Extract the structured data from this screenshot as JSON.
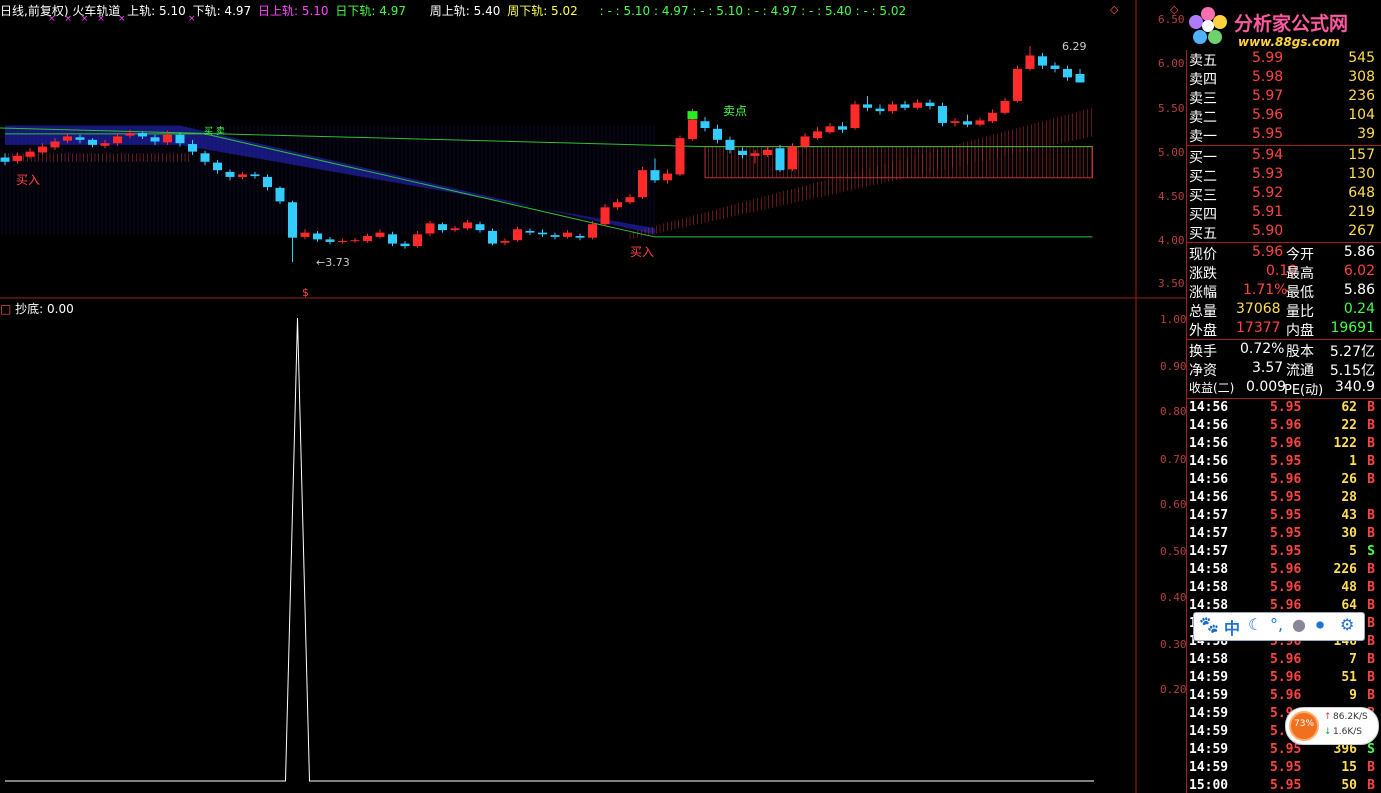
{
  "main_header": {
    "segments": [
      {
        "text": "日线,前复权)",
        "color": "#ffffff"
      },
      {
        "text": "火车轨道",
        "color": "#ffffff"
      },
      {
        "text": "上轨: 5.10",
        "color": "#ffffff"
      },
      {
        "text": "下轨: 4.97",
        "color": "#ffffff"
      },
      {
        "text": "日上轨: 5.10",
        "color": "#ff44ff"
      },
      {
        "text": "日下轨: 4.97",
        "color": "#44ff44"
      },
      {
        "text": "周上轨: 5.40",
        "color": "#ffffff"
      },
      {
        "text": "周下轨: 5.02",
        "color": "#ffff44"
      }
    ],
    "extra": ": - : 5.10 : 4.97 : - : 5.10 : - : 4.97 : - : 5.40 : - : 5.02"
  },
  "x_marks": "× × × ×",
  "x_mark_single_1": "×",
  "x_mark_single_2": "×",
  "main_annotations": {
    "buy1": "买入",
    "buy2": "买入",
    "sell": "卖点",
    "low_label": "←3.73",
    "high_label": "6.29",
    "vert_mark": "买 卖"
  },
  "price_axis": [
    "6.50",
    "6.00",
    "5.50",
    "5.00",
    "4.50",
    "4.00",
    "3.50"
  ],
  "sub_header": "抄底: 0.00",
  "sub_marker": "$",
  "sub_axis": [
    "1.00",
    "0.90",
    "0.80",
    "0.70",
    "0.60",
    "0.50",
    "0.40",
    "0.30",
    "0.20"
  ],
  "order_book": {
    "sell": [
      {
        "label": "卖五",
        "price": "5.99",
        "vol": "545"
      },
      {
        "label": "卖四",
        "price": "5.98",
        "vol": "308"
      },
      {
        "label": "卖三",
        "price": "5.97",
        "vol": "236"
      },
      {
        "label": "卖二",
        "price": "5.96",
        "vol": "104"
      },
      {
        "label": "卖一",
        "price": "5.95",
        "vol": "39"
      }
    ],
    "buy": [
      {
        "label": "买一",
        "price": "5.94",
        "vol": "157"
      },
      {
        "label": "买二",
        "price": "5.93",
        "vol": "130"
      },
      {
        "label": "买三",
        "price": "5.92",
        "vol": "648"
      },
      {
        "label": "买四",
        "price": "5.91",
        "vol": "219"
      },
      {
        "label": "买五",
        "price": "5.90",
        "vol": "267"
      }
    ]
  },
  "quote": [
    {
      "l1": "现价",
      "v1": "5.96",
      "c1": "#ff4444",
      "l2": "今开",
      "v2": "5.86",
      "c2": "#ffffff"
    },
    {
      "l1": "涨跌",
      "v1": "0.10",
      "c1": "#ff4444",
      "l2": "最高",
      "v2": "6.02",
      "c2": "#ff4444"
    },
    {
      "l1": "涨幅",
      "v1": "1.71%",
      "c1": "#ff4444",
      "l2": "最低",
      "v2": "5.86",
      "c2": "#ffffff"
    },
    {
      "l1": "总量",
      "v1": "37068",
      "c1": "#ffdd55",
      "l2": "量比",
      "v2": "0.24",
      "c2": "#44ff44"
    },
    {
      "l1": "外盘",
      "v1": "17377",
      "c1": "#ff4444",
      "l2": "内盘",
      "v2": "19691",
      "c2": "#44ff44"
    }
  ],
  "fund": [
    {
      "l1": "换手",
      "v1": "0.72%",
      "l2": "股本",
      "v2": "5.27亿"
    },
    {
      "l1": "净资",
      "v1": "3.57",
      "l2": "流通",
      "v2": "5.15亿"
    },
    {
      "l1": "收益(二)",
      "v1": "0.009",
      "l2": "PE(动)",
      "v2": "340.9"
    }
  ],
  "ticks": [
    {
      "t": "14:56",
      "p": "5.95",
      "v": "62",
      "s": "B"
    },
    {
      "t": "14:56",
      "p": "5.96",
      "v": "22",
      "s": "B"
    },
    {
      "t": "14:56",
      "p": "5.96",
      "v": "122",
      "s": "B"
    },
    {
      "t": "14:56",
      "p": "5.95",
      "v": "1",
      "s": "B"
    },
    {
      "t": "14:56",
      "p": "5.96",
      "v": "26",
      "s": "B"
    },
    {
      "t": "14:56",
      "p": "5.95",
      "v": "28",
      "s": ""
    },
    {
      "t": "14:57",
      "p": "5.95",
      "v": "43",
      "s": "B"
    },
    {
      "t": "14:57",
      "p": "5.95",
      "v": "30",
      "s": "B"
    },
    {
      "t": "14:57",
      "p": "5.95",
      "v": "5",
      "s": "S"
    },
    {
      "t": "14:58",
      "p": "5.96",
      "v": "226",
      "s": "B"
    },
    {
      "t": "14:58",
      "p": "5.96",
      "v": "48",
      "s": "B"
    },
    {
      "t": "14:58",
      "p": "5.96",
      "v": "64",
      "s": "B"
    },
    {
      "t": "14:58",
      "p": "5.96",
      "v": "",
      "s": "B"
    },
    {
      "t": "14:58",
      "p": "5.96",
      "v": "146",
      "s": "B"
    },
    {
      "t": "14:58",
      "p": "5.96",
      "v": "7",
      "s": "B"
    },
    {
      "t": "14:59",
      "p": "5.96",
      "v": "51",
      "s": "B"
    },
    {
      "t": "14:59",
      "p": "5.96",
      "v": "9",
      "s": "B"
    },
    {
      "t": "14:59",
      "p": "5.9",
      "v": "",
      "s": "B"
    },
    {
      "t": "14:59",
      "p": "5.9",
      "v": "",
      "s": "B"
    },
    {
      "t": "14:59",
      "p": "5.95",
      "v": "396",
      "s": "S"
    },
    {
      "t": "14:59",
      "p": "5.95",
      "v": "15",
      "s": "B"
    },
    {
      "t": "15:00",
      "p": "5.95",
      "v": "50",
      "s": "B"
    }
  ],
  "logo": {
    "title": "分析家公式网",
    "url": "www.88gs.com"
  },
  "ime": {
    "lang": "中"
  },
  "net": {
    "pct": "73%",
    "up": "86.2K/S",
    "down": "1.6K/S"
  },
  "chart_data": {
    "type": "candlestick",
    "y_range": [
      3.4,
      6.6
    ],
    "candles": [
      [
        4.97,
        4.92,
        5.02,
        4.88
      ],
      [
        4.93,
        4.99,
        5.03,
        4.9
      ],
      [
        4.98,
        5.04,
        5.08,
        4.96
      ],
      [
        5.03,
        5.1,
        5.14,
        5.01
      ],
      [
        5.09,
        5.16,
        5.2,
        5.06
      ],
      [
        5.17,
        5.22,
        5.26,
        5.14
      ],
      [
        5.21,
        5.18,
        5.24,
        5.14
      ],
      [
        5.18,
        5.12,
        5.2,
        5.09
      ],
      [
        5.11,
        5.14,
        5.18,
        5.08
      ],
      [
        5.14,
        5.22,
        5.26,
        5.11
      ],
      [
        5.23,
        5.26,
        5.3,
        5.2
      ],
      [
        5.26,
        5.22,
        5.28,
        5.19
      ],
      [
        5.21,
        5.16,
        5.24,
        5.12
      ],
      [
        5.15,
        5.24,
        5.29,
        5.12
      ],
      [
        5.24,
        5.14,
        5.27,
        5.1
      ],
      [
        5.13,
        5.04,
        5.18,
        5.0
      ],
      [
        5.02,
        4.92,
        5.05,
        4.88
      ],
      [
        4.91,
        4.82,
        4.94,
        4.78
      ],
      [
        4.8,
        4.74,
        4.83,
        4.7
      ],
      [
        4.74,
        4.77,
        4.8,
        4.71
      ],
      [
        4.77,
        4.75,
        4.8,
        4.72
      ],
      [
        4.74,
        4.62,
        4.77,
        4.58
      ],
      [
        4.61,
        4.45,
        4.63,
        4.42
      ],
      [
        4.44,
        4.02,
        4.46,
        3.73
      ],
      [
        4.03,
        4.08,
        4.12,
        4.0
      ],
      [
        4.07,
        4.0,
        4.1,
        3.97
      ],
      [
        4.0,
        3.97,
        4.03,
        3.94
      ],
      [
        3.97,
        3.98,
        4.01,
        3.95
      ],
      [
        3.98,
        3.99,
        4.02,
        3.96
      ],
      [
        3.98,
        4.04,
        4.07,
        3.96
      ],
      [
        4.03,
        4.08,
        4.12,
        4.01
      ],
      [
        4.06,
        3.95,
        4.09,
        3.92
      ],
      [
        3.95,
        3.92,
        3.98,
        3.89
      ],
      [
        3.92,
        4.06,
        4.1,
        3.9
      ],
      [
        4.07,
        4.19,
        4.22,
        4.04
      ],
      [
        4.18,
        4.11,
        4.2,
        4.08
      ],
      [
        4.11,
        4.13,
        4.16,
        4.09
      ],
      [
        4.13,
        4.2,
        4.23,
        4.11
      ],
      [
        4.18,
        4.11,
        4.21,
        4.08
      ],
      [
        4.1,
        3.95,
        4.13,
        3.93
      ],
      [
        3.96,
        3.98,
        4.01,
        3.93
      ],
      [
        3.99,
        4.12,
        4.15,
        3.97
      ],
      [
        4.1,
        4.08,
        4.13,
        4.05
      ],
      [
        4.08,
        4.06,
        4.12,
        4.03
      ],
      [
        4.05,
        4.03,
        4.08,
        4.0
      ],
      [
        4.03,
        4.08,
        4.11,
        4.01
      ],
      [
        4.04,
        4.02,
        4.07,
        3.99
      ],
      [
        4.02,
        4.18,
        4.22,
        4.0
      ],
      [
        4.18,
        4.38,
        4.42,
        4.16
      ],
      [
        4.38,
        4.44,
        4.48,
        4.35
      ],
      [
        4.44,
        4.5,
        4.54,
        4.42
      ],
      [
        4.5,
        4.82,
        4.86,
        4.48
      ],
      [
        4.82,
        4.7,
        4.96,
        4.67
      ],
      [
        4.7,
        4.78,
        4.83,
        4.66
      ],
      [
        4.77,
        5.2,
        5.23,
        4.75
      ],
      [
        5.19,
        5.42,
        5.55,
        5.17
      ],
      [
        5.4,
        5.32,
        5.45,
        5.28
      ],
      [
        5.31,
        5.18,
        5.36,
        5.14
      ],
      [
        5.18,
        5.06,
        5.22,
        5.02
      ],
      [
        5.05,
        5.0,
        5.09,
        4.96
      ],
      [
        4.99,
        5.02,
        5.06,
        4.9
      ],
      [
        5.0,
        5.06,
        5.1,
        4.98
      ],
      [
        5.08,
        4.82,
        5.12,
        4.8
      ],
      [
        4.83,
        5.1,
        5.14,
        4.81
      ],
      [
        5.1,
        5.22,
        5.26,
        5.08
      ],
      [
        5.2,
        5.28,
        5.33,
        5.18
      ],
      [
        5.27,
        5.34,
        5.38,
        5.25
      ],
      [
        5.34,
        5.3,
        5.39,
        5.26
      ],
      [
        5.32,
        5.6,
        5.64,
        5.3
      ],
      [
        5.6,
        5.56,
        5.7,
        5.52
      ],
      [
        5.55,
        5.52,
        5.6,
        5.48
      ],
      [
        5.52,
        5.6,
        5.64,
        5.49
      ],
      [
        5.6,
        5.56,
        5.64,
        5.53
      ],
      [
        5.56,
        5.62,
        5.66,
        5.54
      ],
      [
        5.62,
        5.58,
        5.66,
        5.54
      ],
      [
        5.58,
        5.38,
        5.62,
        5.34
      ],
      [
        5.38,
        5.4,
        5.44,
        5.34
      ],
      [
        5.4,
        5.36,
        5.48,
        5.33
      ],
      [
        5.36,
        5.41,
        5.44,
        5.34
      ],
      [
        5.4,
        5.5,
        5.54,
        5.38
      ],
      [
        5.5,
        5.64,
        5.68,
        5.48
      ],
      [
        5.64,
        6.02,
        6.06,
        5.62
      ],
      [
        6.02,
        6.18,
        6.29,
        6.0
      ],
      [
        6.17,
        6.06,
        6.21,
        6.02
      ],
      [
        6.06,
        6.02,
        6.1,
        5.98
      ],
      [
        6.02,
        5.92,
        6.06,
        5.88
      ],
      [
        5.96,
        5.86,
        6.02,
        5.86
      ]
    ],
    "sub_series": {
      "name": "抄底",
      "spike_index": 23,
      "values_base": 0,
      "spike_value": 1.0
    }
  }
}
